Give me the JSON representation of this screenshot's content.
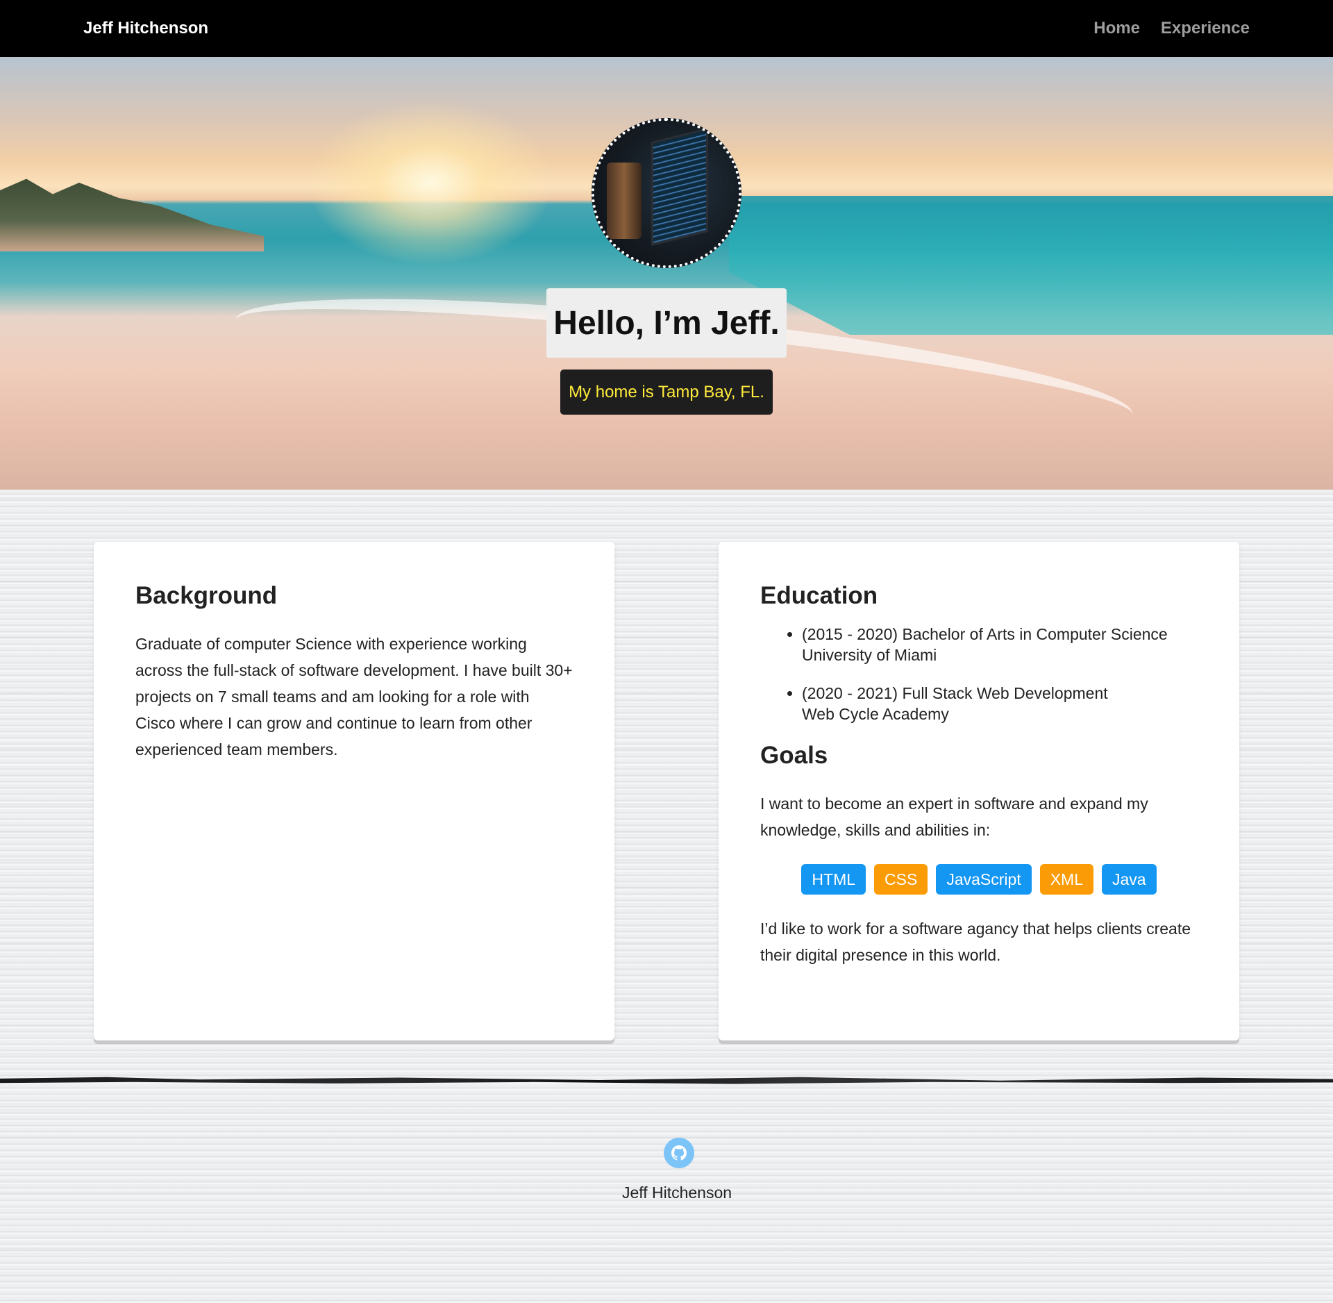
{
  "navbar": {
    "brand": "Jeff Hitchenson",
    "links": [
      "Home",
      "Experience"
    ]
  },
  "hero": {
    "title": "Hello, I’m Jeff.",
    "subtitle": "My home is Tamp Bay, FL."
  },
  "background": {
    "heading": "Background",
    "text": "Graduate of computer Science with experience working across the full-stack of software development. I have built 30+ projects on 7 small teams and am looking for a role with Cisco where I can grow and continue to learn from other experienced team members."
  },
  "education": {
    "heading": "Education",
    "items": [
      {
        "line1": "(2015 - 2020) Bachelor of Arts in Computer Science",
        "line2": "University of Miami"
      },
      {
        "line1": "(2020 - 2021) Full Stack Web Development",
        "line2": "Web Cycle Academy"
      }
    ]
  },
  "goals": {
    "heading": "Goals",
    "intro": "I want to become an expert in software and expand my knowledge, skills and abilities in:",
    "tags": [
      {
        "label": "HTML",
        "color": "#1496f3"
      },
      {
        "label": "CSS",
        "color": "#fb9b06"
      },
      {
        "label": "JavaScript",
        "color": "#1496f3"
      },
      {
        "label": "XML",
        "color": "#fb9b06"
      },
      {
        "label": "Java",
        "color": "#1496f3"
      }
    ],
    "outro": "I’d like to work for a software agancy that helps clients create their digital presence in this world."
  },
  "footer": {
    "icon": "github-icon",
    "name": "Jeff Hitchenson"
  },
  "colors": {
    "navbar_bg": "#000000",
    "subtitle_text": "#ffeb3b",
    "tag_blue": "#1496f3",
    "tag_orange": "#fb9b06",
    "github_circle": "#7cc4f8"
  }
}
